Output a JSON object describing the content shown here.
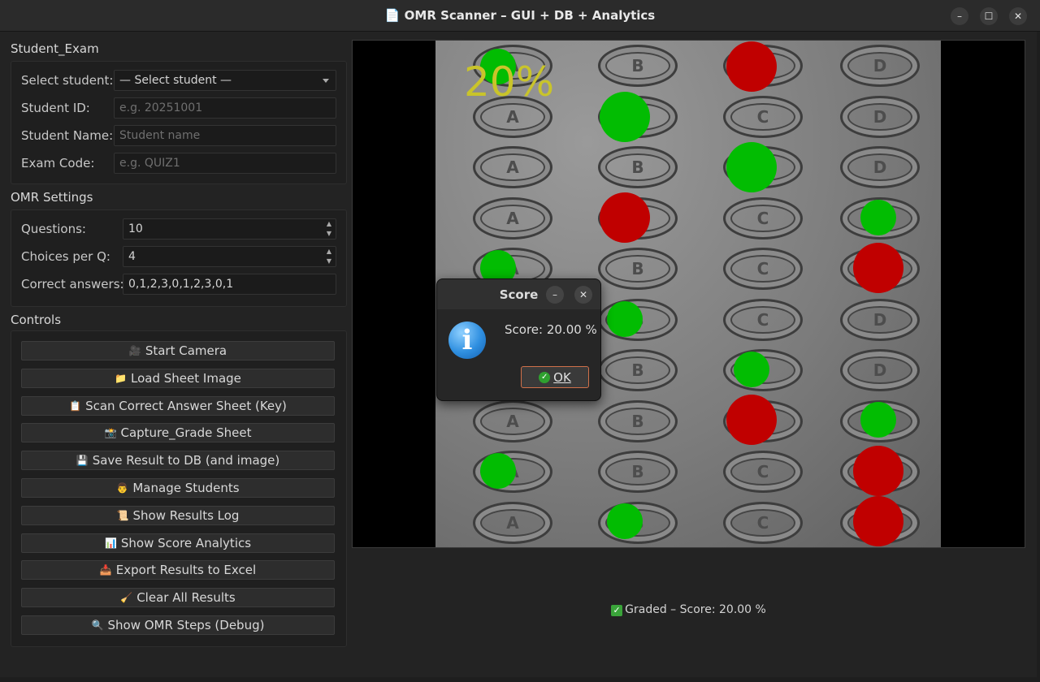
{
  "window": {
    "title": "OMR Scanner – GUI + DB + Analytics",
    "title_icon": "document-icon"
  },
  "sections": {
    "student_exam": {
      "title": "Student_Exam",
      "select_label": "Select student:",
      "select_value": "— Select student —",
      "id_label": "Student ID:",
      "id_placeholder": "e.g. 20251001",
      "name_label": "Student Name:",
      "name_placeholder": "Student name",
      "exam_label": "Exam Code:",
      "exam_placeholder": "e.g. QUIZ1"
    },
    "omr": {
      "title": "OMR Settings",
      "questions_label": "Questions:",
      "questions_value": "10",
      "choices_label": "Choices per Q:",
      "choices_value": "4",
      "answers_label": "Correct answers:",
      "answers_value": "0,1,2,3,0,1,2,3,0,1"
    },
    "controls": {
      "title": "Controls",
      "buttons": [
        {
          "icon": "🎥",
          "label": "Start Camera"
        },
        {
          "icon": "📁",
          "label": "Load Sheet Image"
        },
        {
          "icon": "📋",
          "label": "Scan Correct Answer Sheet (Key)"
        },
        {
          "icon": "📸",
          "label": "Capture_Grade Sheet"
        },
        {
          "icon": "💾",
          "label": "Save Result to DB (and image)"
        },
        {
          "icon": "👨",
          "label": "Manage Students"
        },
        {
          "icon": "📜",
          "label": "Show Results Log"
        },
        {
          "icon": "📊",
          "label": "Show Score Analytics"
        },
        {
          "icon": "📥",
          "label": "Export Results to Excel"
        },
        {
          "icon": "🧹",
          "label": "Clear All Results"
        },
        {
          "icon": "🔍",
          "label": "Show OMR Steps (Debug)"
        }
      ]
    }
  },
  "preview": {
    "overlay_score": "20%",
    "choice_letters": [
      "A",
      "B",
      "C",
      "D"
    ],
    "colors": {
      "correct": "#02bc02",
      "wrong": "#c00000"
    }
  },
  "status": {
    "text": "Graded – Score: 20.00 %"
  },
  "dialog": {
    "title": "Score",
    "message": "Score: 20.00 %",
    "ok_label": "OK"
  }
}
